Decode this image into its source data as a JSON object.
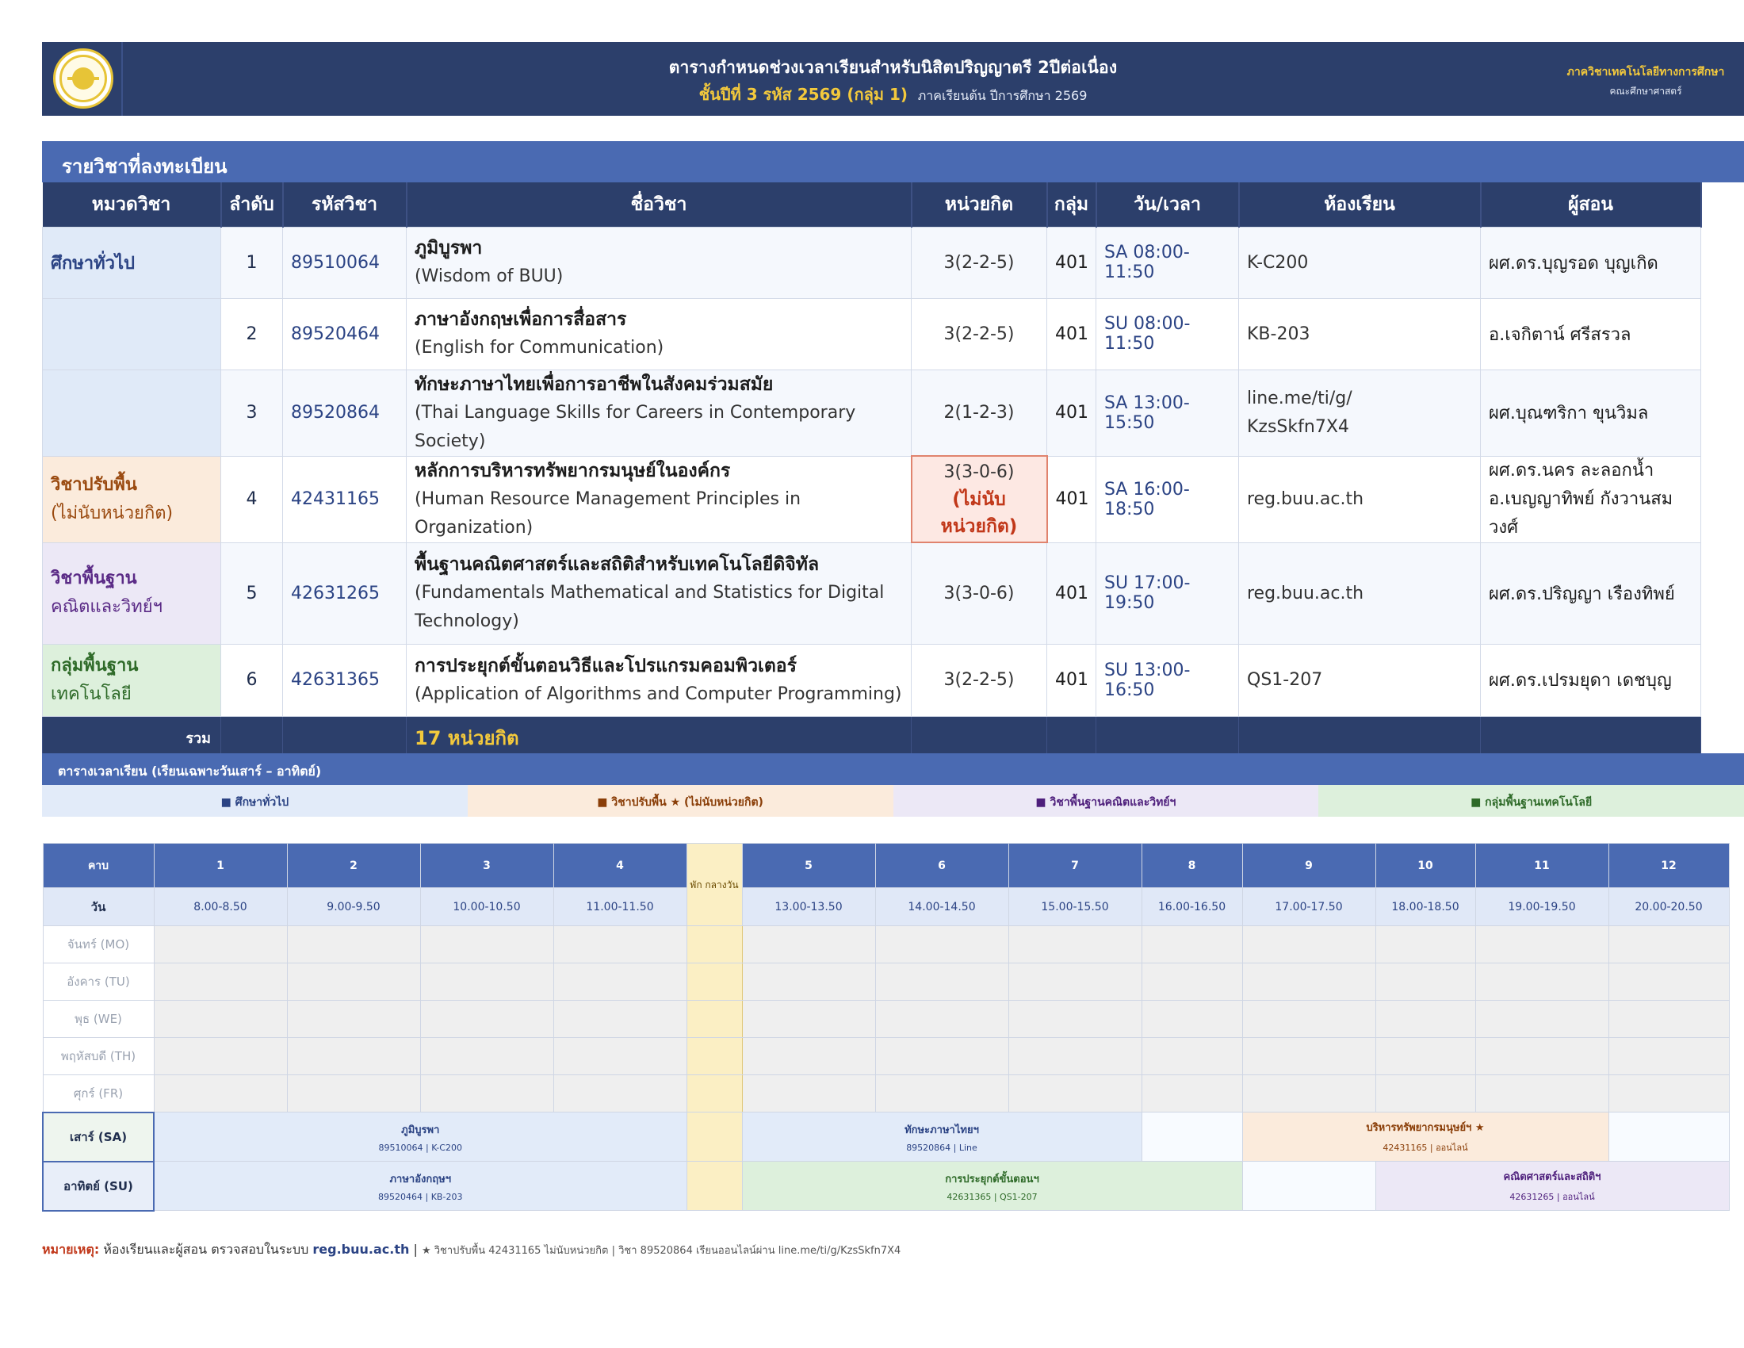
{
  "header": {
    "title_line1": "ตารางกำหนดช่วงเวลาเรียนสำหรับนิสิตปริญญาตรี 2ปีต่อเนื่อง",
    "title_line2_highlight": "ชั้นปีที่ 3 รหัส 2569 (กลุ่ม 1)",
    "title_line2_rest": "ภาคเรียนต้น ปีการศึกษา 2569",
    "dept_line1": "ภาควิชาเทคโนโลยีทางการศึกษา",
    "dept_line2": "คณะศึกษาศาสตร์",
    "logo_icon": "university-seal-icon"
  },
  "courses_section": {
    "title": "รายวิชาที่ลงทะเบียน",
    "columns": [
      "หมวดวิชา",
      "ลำดับ",
      "รหัสวิชา",
      "ชื่อวิชา",
      "หน่วยกิต",
      "กลุ่ม",
      "วัน/เวลา",
      "ห้องเรียน",
      "ผู้สอน"
    ],
    "rows": [
      {
        "cat": "ศึกษาทั่วไป",
        "cat_sub": "",
        "no": "1",
        "code": "89510064",
        "name_th": "ภูมิบูรพา",
        "name_en": "(Wisdom of BUU)",
        "credit": "3(2-2-5)",
        "credit_note": "",
        "group": "401",
        "time": "SA 08:00-11:50",
        "room": "K-C200",
        "teacher": "ผศ.ดร.บุญรอด บุญเกิด",
        "teacher2": ""
      },
      {
        "cat": "",
        "cat_sub": "",
        "no": "2",
        "code": "89520464",
        "name_th": "ภาษาอังกฤษเพื่อการสื่อสาร",
        "name_en": "(English for Communication)",
        "credit": "3(2-2-5)",
        "credit_note": "",
        "group": "401",
        "time": "SU 08:00-11:50",
        "room": "KB-203",
        "teacher": "อ.เจกิตาน์ ศรีสรวล",
        "teacher2": ""
      },
      {
        "cat": "",
        "cat_sub": "",
        "no": "3",
        "code": "89520864",
        "name_th": "ทักษะภาษาไทยเพื่อการอาชีพในสังคมร่วมสมัย",
        "name_en": "(Thai Language Skills for Careers in Contemporary Society)",
        "credit": "2(1-2-3)",
        "credit_note": "",
        "group": "401",
        "time": "SA 13:00-15:50",
        "room": "line.me/ti/g/",
        "room2": "KzsSkfn7X4",
        "teacher": "ผศ.บุณฑริกา ขุนวิมล",
        "teacher2": ""
      },
      {
        "cat": "วิชาปรับพื้น",
        "cat_sub": "(ไม่นับหน่วยกิต)",
        "no": "4",
        "code": "42431165",
        "name_th": "หลักการบริหารทรัพยากรมนุษย์ในองค์กร",
        "name_en": "(Human Resource Management Principles in Organization)",
        "credit": "3(3-0-6)",
        "credit_note": "(ไม่นับหน่วยกิต)",
        "group": "401",
        "time": "SA 16:00-18:50",
        "room": "reg.buu.ac.th",
        "teacher": "ผศ.ดร.นคร ละลอกน้ำ",
        "teacher2": "อ.เบญญาทิพย์ กังวานสมวงศ์"
      },
      {
        "cat": "วิชาพื้นฐาน",
        "cat_sub": "คณิตและวิทย์ฯ",
        "no": "5",
        "code": "42631265",
        "name_th": "พื้นฐานคณิตศาสตร์และสถิติสำหรับเทคโนโลยีดิจิทัล",
        "name_en": "(Fundamentals Mathematical and Statistics for Digital",
        "name_en2": "Technology)",
        "credit": "3(3-0-6)",
        "credit_note": "",
        "group": "401",
        "time": "SU 17:00-19:50",
        "room": "reg.buu.ac.th",
        "teacher": "ผศ.ดร.ปริญญา เรืองทิพย์",
        "teacher2": ""
      },
      {
        "cat": "กลุ่มพื้นฐาน",
        "cat_sub": "เทคโนโลยี",
        "no": "6",
        "code": "42631365",
        "name_th": "การประยุกต์ขั้นตอนวิธีและโปรแกรมคอมพิวเตอร์",
        "name_en": "(Application of Algorithms and Computer Programming)",
        "credit": "3(2-2-5)",
        "credit_note": "",
        "group": "401",
        "time": "SU 13:00-16:50",
        "room": "QS1-207",
        "teacher": "ผศ.ดร.เปรมยุดา เดชบุญ",
        "teacher2": ""
      }
    ],
    "total_label": "รวม",
    "total_value": "17 หน่วยกิต"
  },
  "timetable": {
    "title": "ตารางเวลาเรียน (เรียนเฉพาะวันเสาร์ – อาทิตย์)",
    "legend": [
      "■ ศึกษาทั่วไป",
      "■ วิชาปรับพื้น ★ (ไม่นับหน่วยกิต)",
      "■ วิชาพื้นฐานคณิตและวิทย์ฯ",
      "■ กลุ่มพื้นฐานเทคโนโลยี"
    ],
    "period_label": "คาบ",
    "day_label": "วัน",
    "lunch_label": "พัก กลางวัน",
    "periods": [
      "1",
      "2",
      "3",
      "4",
      "5",
      "6",
      "7",
      "8",
      "9",
      "10",
      "11",
      "12"
    ],
    "times": [
      "8.00-8.50",
      "9.00-9.50",
      "10.00-10.50",
      "11.00-11.50",
      "13.00-13.50",
      "14.00-14.50",
      "15.00-15.50",
      "16.00-16.50",
      "17.00-17.50",
      "18.00-18.50",
      "19.00-19.50",
      "20.00-20.50"
    ],
    "weekdays": [
      "จันทร์ (MO)",
      "อังคาร (TU)",
      "พุธ (WE)",
      "พฤหัสบดี (TH)",
      "ศุกร์ (FR)"
    ],
    "sat": {
      "label": "เสาร์ (SA)",
      "b1_title": "ภูมิบูรพา",
      "b1_sub": "89510064 | K-C200",
      "b2_title": "ทักษะภาษาไทยฯ",
      "b2_sub": "89520864 | Line",
      "b3_title": "บริหารทรัพยากรมนุษย์ฯ ★",
      "b3_sub": "42431165 | ออนไลน์"
    },
    "sun": {
      "label": "อาทิตย์ (SU)",
      "b1_title": "ภาษาอังกฤษฯ",
      "b1_sub": "89520464 | KB-203",
      "b2_title": "การประยุกต์ขั้นตอนฯ",
      "b2_sub": "42631365 | QS1-207",
      "b3_title": "คณิตศาสตร์และสถิติฯ",
      "b3_sub": "42631265 | ออนไลน์"
    }
  },
  "footnote": {
    "label": "หมายเหตุ:",
    "text1": "ห้องเรียนและผู้สอน ตรวจสอบในระบบ",
    "link": "reg.buu.ac.th",
    "sep": "|",
    "text2": "★ วิชาปรับพื้น 42431165 ไม่นับหน่วยกิต | วิชา 89520864 เรียนออนไลน์ผ่าน line.me/ti/g/KzsSkfn7X4"
  }
}
